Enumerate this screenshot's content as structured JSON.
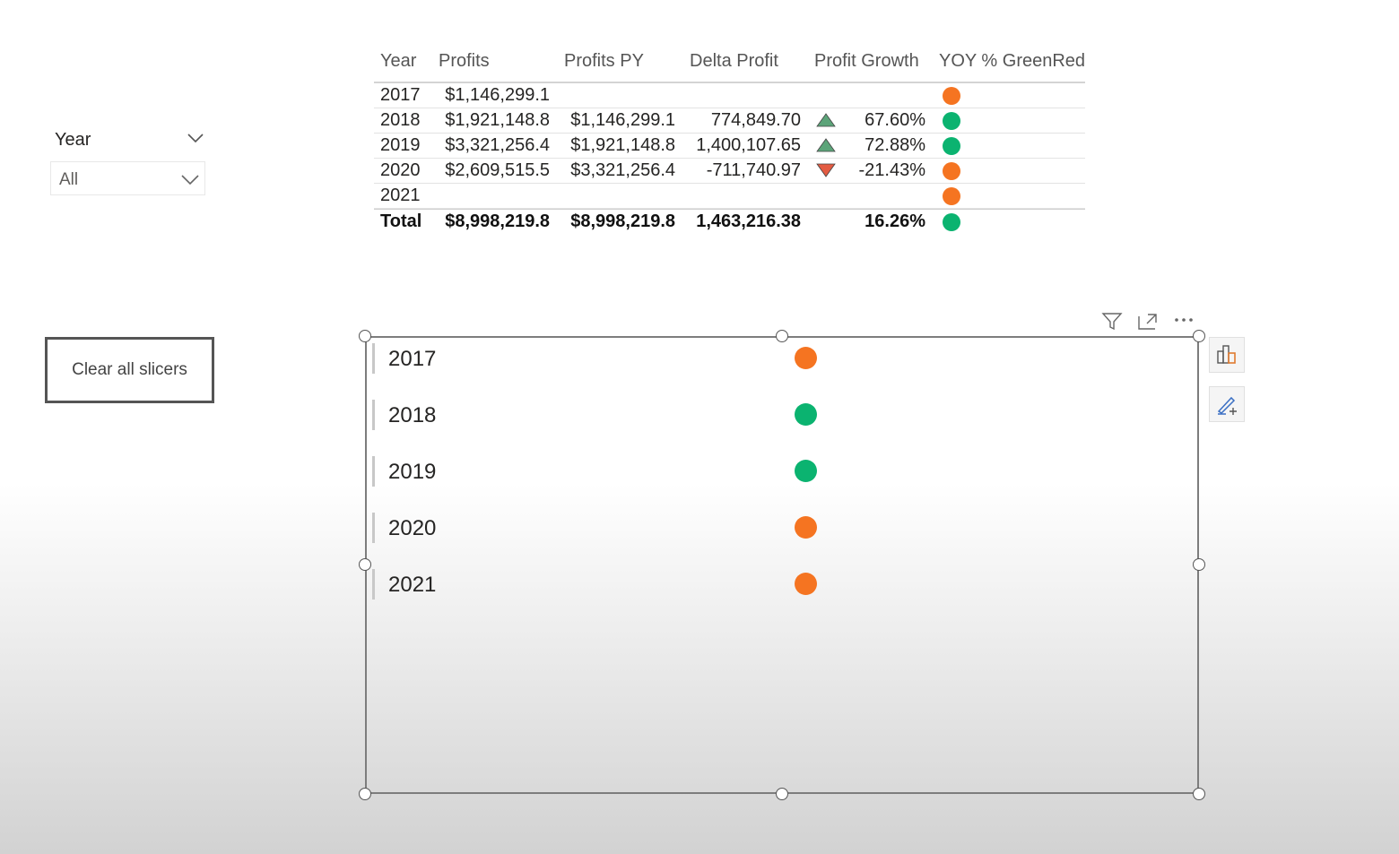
{
  "slicer": {
    "title": "Year",
    "selected": "All"
  },
  "clear_button": {
    "label": "Clear all slicers"
  },
  "table": {
    "headers": [
      "Year",
      "Profits",
      "Profits PY",
      "Delta Profit",
      "Profit Growth",
      "YOY % GreenRed"
    ],
    "rows": [
      {
        "year": "2017",
        "profits": "$1,146,299.1",
        "profits_py": "",
        "delta": "",
        "growth": "",
        "arrow": "none",
        "status": "orange"
      },
      {
        "year": "2018",
        "profits": "$1,921,148.8",
        "profits_py": "$1,146,299.1",
        "delta": "774,849.70",
        "growth": "67.60%",
        "arrow": "up",
        "status": "green"
      },
      {
        "year": "2019",
        "profits": "$3,321,256.4",
        "profits_py": "$1,921,148.8",
        "delta": "1,400,107.65",
        "growth": "72.88%",
        "arrow": "up",
        "status": "green"
      },
      {
        "year": "2020",
        "profits": "$2,609,515.5",
        "profits_py": "$3,321,256.4",
        "delta": "-711,740.97",
        "growth": "-21.43%",
        "arrow": "down",
        "status": "orange"
      },
      {
        "year": "2021",
        "profits": "",
        "profits_py": "",
        "delta": "",
        "growth": "",
        "arrow": "none",
        "status": "orange"
      }
    ],
    "total": {
      "year": "Total",
      "profits": "$8,998,219.8",
      "profits_py": "$8,998,219.8",
      "delta": "1,463,216.38",
      "growth": "16.26%",
      "status": "green"
    }
  },
  "visual_list": [
    {
      "year": "2017",
      "status": "orange"
    },
    {
      "year": "2018",
      "status": "green"
    },
    {
      "year": "2019",
      "status": "green"
    },
    {
      "year": "2020",
      "status": "orange"
    },
    {
      "year": "2021",
      "status": "orange"
    }
  ],
  "visual_header_icons": [
    "filter-icon",
    "focus-mode-icon",
    "more-options-icon"
  ],
  "side_buttons": [
    "build-visual-icon",
    "format-visual-icon"
  ],
  "colors": {
    "green": "#0bb370",
    "orange": "#f57421",
    "up_arrow": "#4a9a6a",
    "down_arrow": "#e0492e"
  }
}
